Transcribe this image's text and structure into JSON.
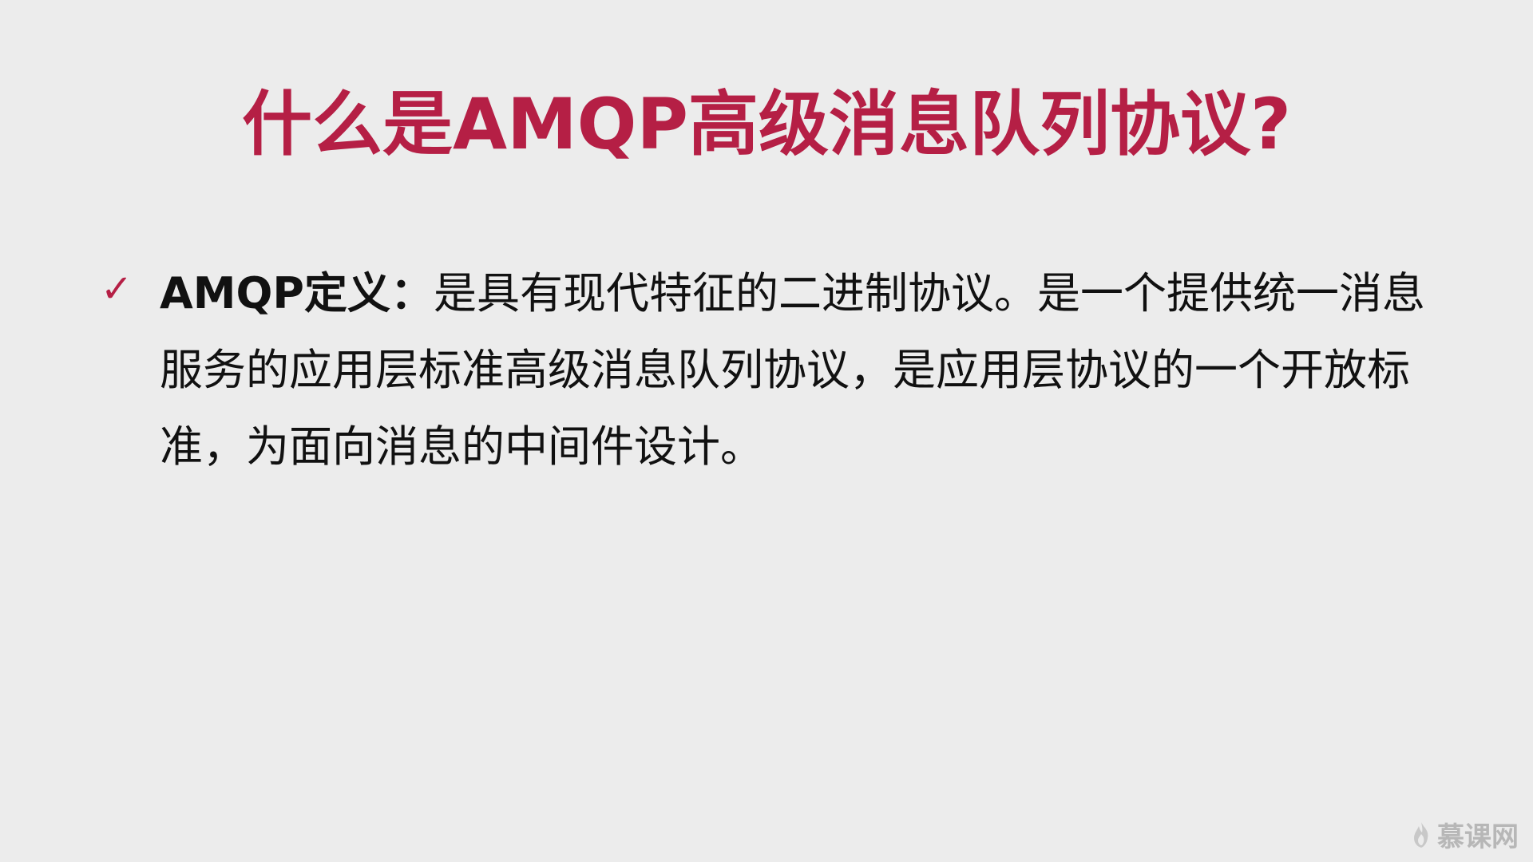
{
  "slide": {
    "title": "什么是AMQP高级消息队列协议?",
    "bullets": [
      {
        "icon": "check-icon",
        "label": "AMQP定义：",
        "text": "是具有现代特征的二进制协议。是一个提供统一消息服务的应用层标准高级消息队列协议，是应用层协议的一个开放标准，为面向消息的中间件设计。"
      }
    ]
  },
  "watermark": {
    "text": "慕课网",
    "icon": "flame-icon"
  }
}
